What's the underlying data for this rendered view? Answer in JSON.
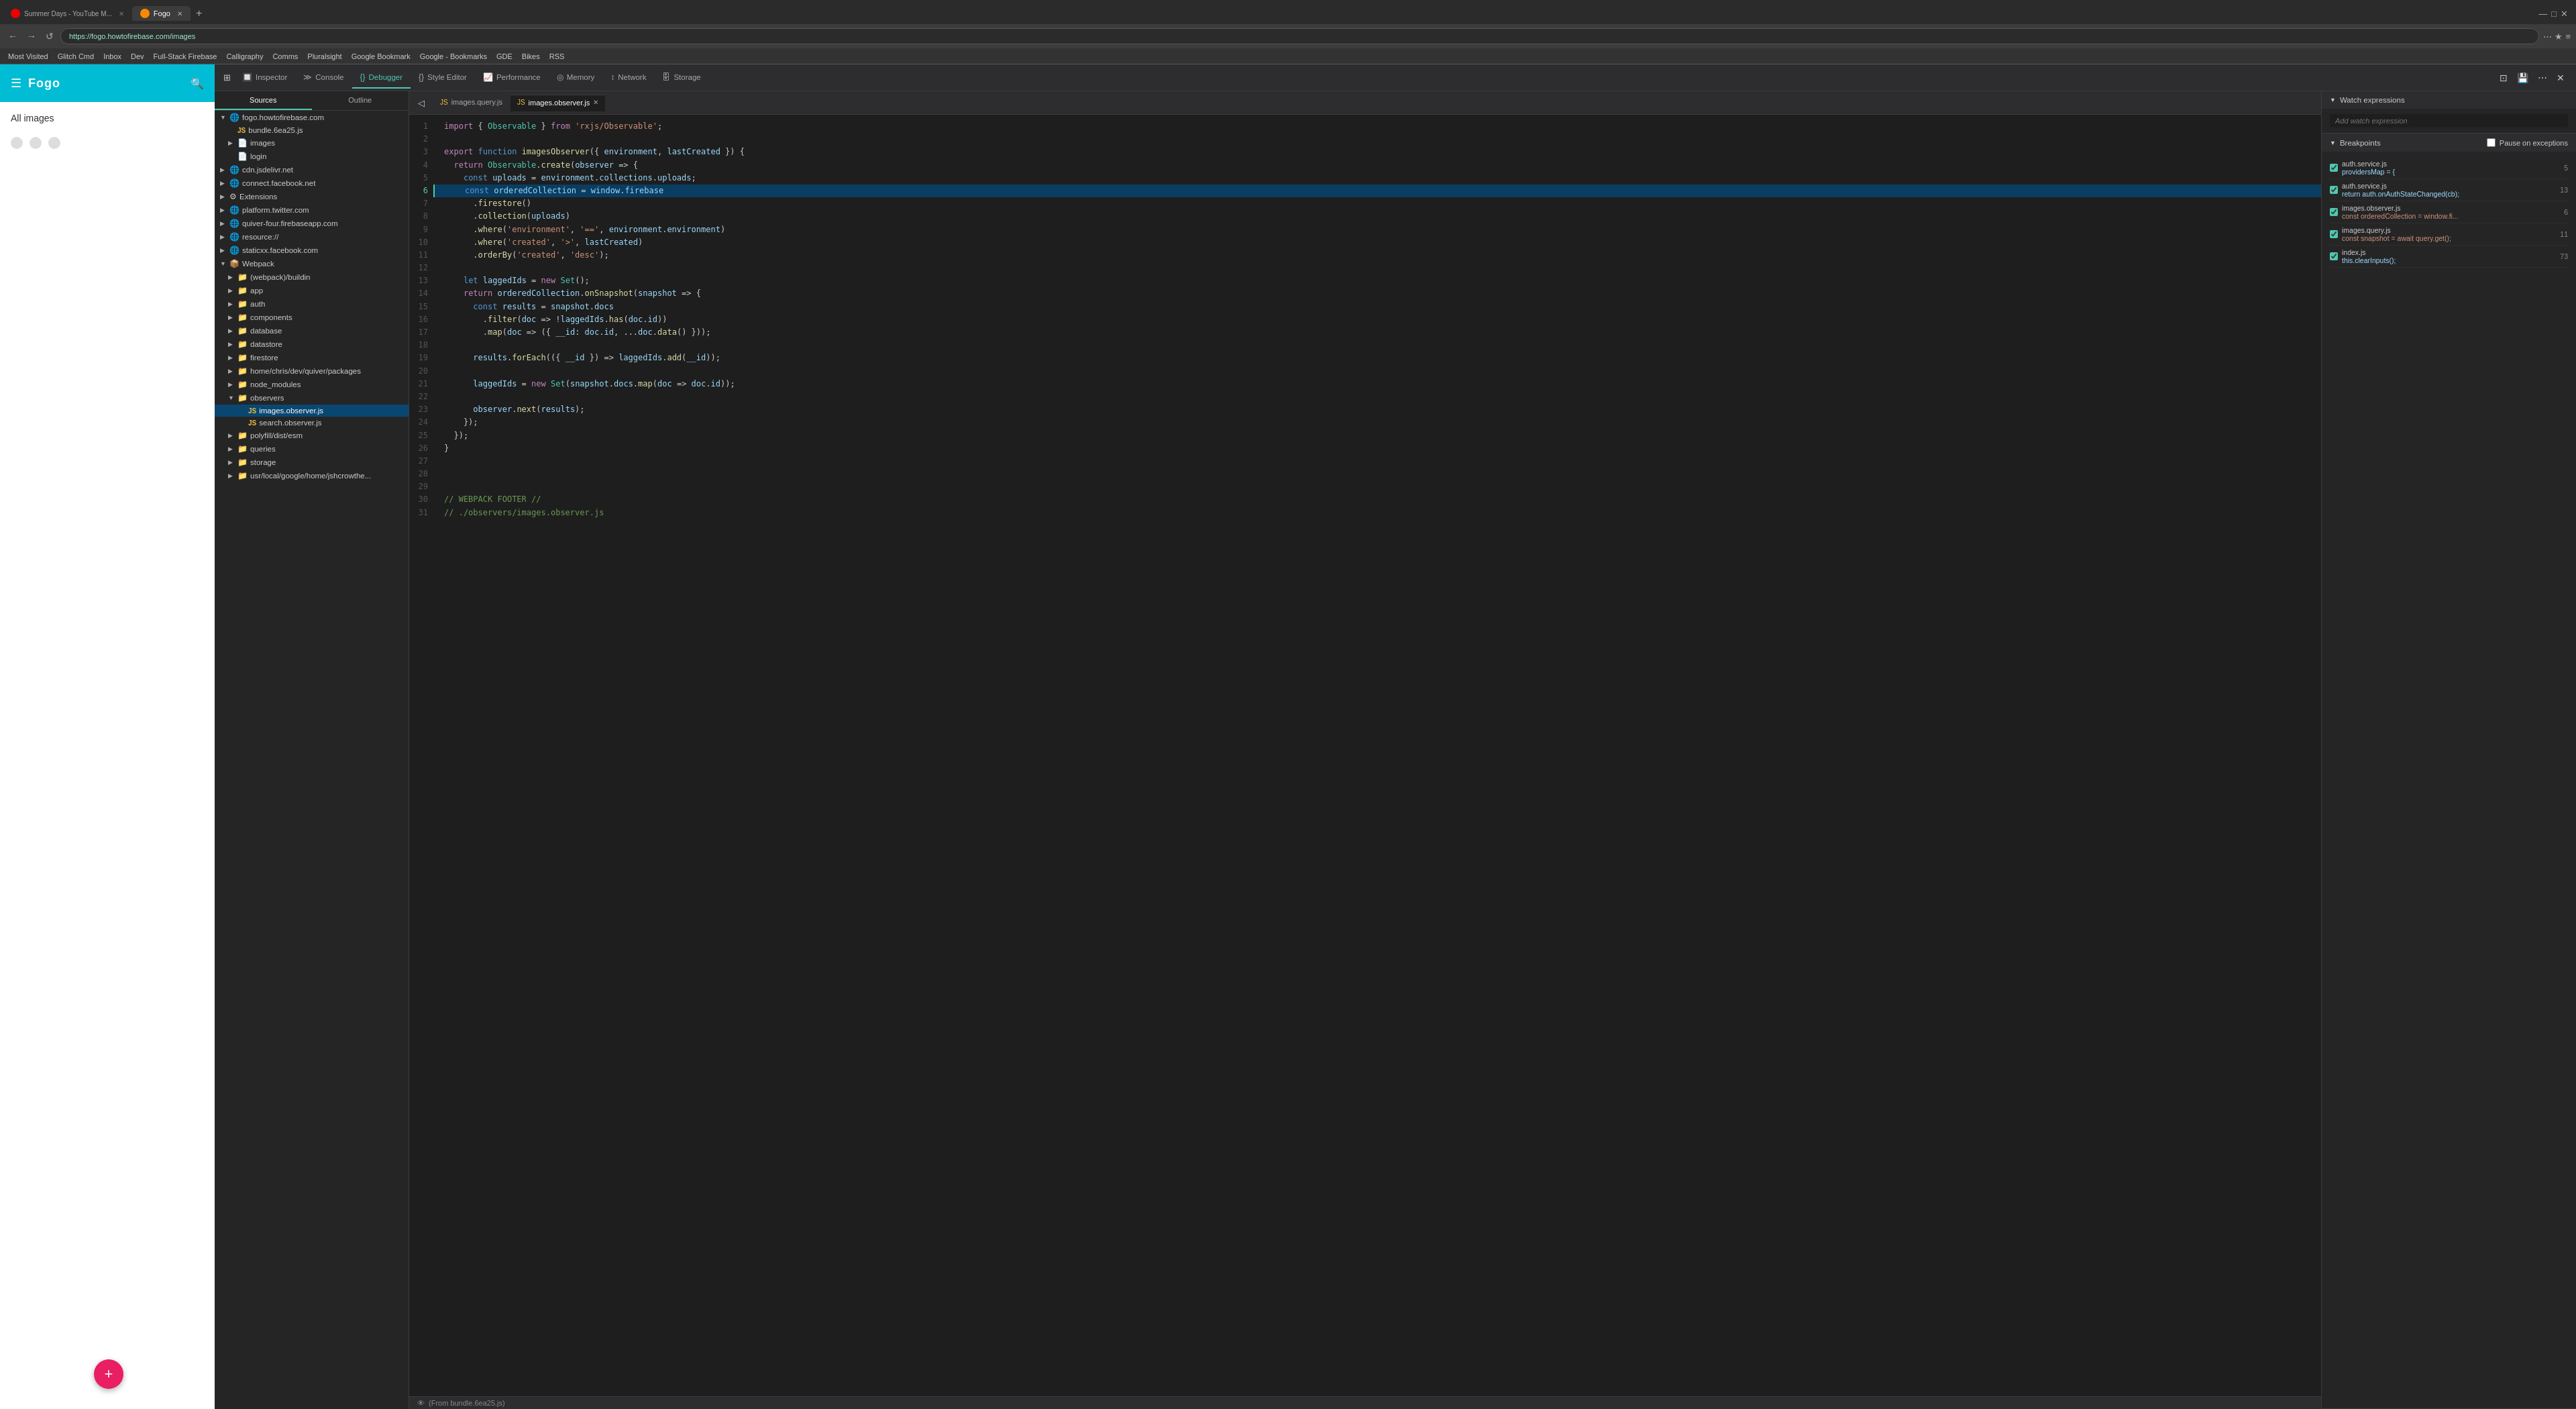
{
  "browser": {
    "tabs": [
      {
        "label": "Summer Days - YouTube M...",
        "favicon_color": "#e00",
        "active": false
      },
      {
        "label": "Fogo",
        "favicon_color": "#f60",
        "active": true
      }
    ],
    "url": "https://fogo.howtofirebase.com/images",
    "bookmarks": [
      "Most Visited",
      "Glitch Cmd",
      "Inbox",
      "Dev",
      "Full-Stack Firebase",
      "Calligraphy",
      "Comms",
      "Pluralsight",
      "Google Bookmark",
      "Google - Bookmarks",
      "GDE",
      "Bikes",
      "RSS"
    ]
  },
  "devtools": {
    "tabs": [
      {
        "label": "Inspector",
        "icon": "🔲",
        "active": false
      },
      {
        "label": "Console",
        "icon": "≡",
        "active": false
      },
      {
        "label": "Debugger",
        "icon": "{}",
        "active": true
      },
      {
        "label": "Style Editor",
        "icon": "{}",
        "active": false
      },
      {
        "label": "Performance",
        "icon": "📈",
        "active": false
      },
      {
        "label": "Memory",
        "icon": "◎",
        "active": false
      },
      {
        "label": "Network",
        "icon": "↕",
        "active": false
      },
      {
        "label": "Storage",
        "icon": "🗄",
        "active": false
      }
    ]
  },
  "sidebar_app": {
    "logo": "Fogo",
    "title": "All images"
  },
  "file_tree": {
    "tabs": [
      "Sources",
      "Outline"
    ],
    "items": [
      {
        "indent": 0,
        "arrow": "▼",
        "icon": "🌐",
        "label": "fogo.howtofirebase.com",
        "type": "domain"
      },
      {
        "indent": 1,
        "arrow": "",
        "icon": "JS",
        "label": "bundle.6ea25.js",
        "type": "js"
      },
      {
        "indent": 1,
        "arrow": "▶",
        "icon": "📄",
        "label": "images",
        "type": "folder"
      },
      {
        "indent": 1,
        "arrow": "",
        "icon": "📄",
        "label": "login",
        "type": "folder"
      },
      {
        "indent": 0,
        "arrow": "▶",
        "icon": "🌐",
        "label": "cdn.jsdelivr.net",
        "type": "domain"
      },
      {
        "indent": 0,
        "arrow": "▶",
        "icon": "🌐",
        "label": "connect.facebook.net",
        "type": "domain"
      },
      {
        "indent": 0,
        "arrow": "▶",
        "icon": "⚙",
        "label": "Extensions",
        "type": "domain"
      },
      {
        "indent": 0,
        "arrow": "▶",
        "icon": "🌐",
        "label": "platform.twitter.com",
        "type": "domain"
      },
      {
        "indent": 0,
        "arrow": "▶",
        "icon": "🌐",
        "label": "quiver-four.firebaseapp.com",
        "type": "domain"
      },
      {
        "indent": 0,
        "arrow": "▶",
        "icon": "🌐",
        "label": "resource://",
        "type": "domain"
      },
      {
        "indent": 0,
        "arrow": "▶",
        "icon": "🌐",
        "label": "staticxx.facebook.com",
        "type": "domain"
      },
      {
        "indent": 0,
        "arrow": "▼",
        "icon": "📦",
        "label": "Webpack",
        "type": "domain"
      },
      {
        "indent": 1,
        "arrow": "▶",
        "icon": "📁",
        "label": "(webpack)/buildin",
        "type": "folder"
      },
      {
        "indent": 1,
        "arrow": "▶",
        "icon": "📁",
        "label": "app",
        "type": "folder"
      },
      {
        "indent": 1,
        "arrow": "▶",
        "icon": "📁",
        "label": "auth",
        "type": "folder"
      },
      {
        "indent": 1,
        "arrow": "▶",
        "icon": "📁",
        "label": "components",
        "type": "folder"
      },
      {
        "indent": 1,
        "arrow": "▶",
        "icon": "📁",
        "label": "database",
        "type": "folder"
      },
      {
        "indent": 1,
        "arrow": "▶",
        "icon": "📁",
        "label": "datastore",
        "type": "folder"
      },
      {
        "indent": 1,
        "arrow": "▶",
        "icon": "📁",
        "label": "firestore",
        "type": "folder"
      },
      {
        "indent": 1,
        "arrow": "▶",
        "icon": "📁",
        "label": "home/chris/dev/quiver/packages",
        "type": "folder"
      },
      {
        "indent": 1,
        "arrow": "▶",
        "icon": "📁",
        "label": "node_modules",
        "type": "folder"
      },
      {
        "indent": 1,
        "arrow": "▼",
        "icon": "📁",
        "label": "observers",
        "type": "folder"
      },
      {
        "indent": 2,
        "arrow": "",
        "icon": "JS",
        "label": "images.observer.js",
        "type": "js",
        "selected": true
      },
      {
        "indent": 2,
        "arrow": "",
        "icon": "JS",
        "label": "search.observer.js",
        "type": "js"
      },
      {
        "indent": 1,
        "arrow": "▶",
        "icon": "📁",
        "label": "polyfill/dist/esm",
        "type": "folder"
      },
      {
        "indent": 1,
        "arrow": "▶",
        "icon": "📁",
        "label": "queries",
        "type": "folder"
      },
      {
        "indent": 1,
        "arrow": "▶",
        "icon": "📁",
        "label": "storage",
        "type": "folder"
      },
      {
        "indent": 1,
        "arrow": "▶",
        "icon": "📁",
        "label": "usr/local/google/home/jshcrowthe...",
        "type": "folder"
      }
    ]
  },
  "code_editor": {
    "tabs": [
      {
        "label": "images.query.js",
        "active": false,
        "closeable": false
      },
      {
        "label": "images.observer.js",
        "active": true,
        "closeable": true
      }
    ],
    "lines": [
      {
        "n": 1,
        "code": "<kw>import</kw> { <cls>Observable</cls> } <kw>from</kw> <str>'rxjs/Observable'</str>;",
        "highlight": false
      },
      {
        "n": 2,
        "code": "",
        "highlight": false
      },
      {
        "n": 3,
        "code": "<kw>export</kw> <kw2>function</kw2> <fn>imagesObserver</fn>({ <var>environment</var>, <var>lastCreated</var> }) {",
        "highlight": false
      },
      {
        "n": 4,
        "code": "  <kw>return</kw> <cls>Observable</cls>.<fn>create</fn>(<var>observer</var> => {",
        "highlight": false
      },
      {
        "n": 5,
        "code": "    <kw2>const</kw2> <var>uploads</var> = <var>environment</var>.<prop>collections</prop>.<prop>uploads</prop>;",
        "highlight": false
      },
      {
        "n": 6,
        "code": "    <kw2>const</kw2> <var>orderedCollection</var> = <var>window</var>.<prop>firebase</prop>",
        "highlight": true,
        "breakpoint": true
      },
      {
        "n": 7,
        "code": "      .<fn>firestore</fn>()",
        "highlight": false
      },
      {
        "n": 8,
        "code": "      .<fn>collection</fn>(<var>uploads</var>)",
        "highlight": false
      },
      {
        "n": 9,
        "code": "      .<fn>where</fn>(<str>'environment'</str>, <str>'=='</str>, <var>environment</var>.<prop>environment</prop>)",
        "highlight": false
      },
      {
        "n": 10,
        "code": "      .<fn>where</fn>(<str>'created'</str>, <str>'>'</str>, <var>lastCreated</var>)",
        "highlight": false
      },
      {
        "n": 11,
        "code": "      .<fn>orderBy</fn>(<str>'created'</str>, <str>'desc'</str>);",
        "highlight": false
      },
      {
        "n": 12,
        "code": "",
        "highlight": false
      },
      {
        "n": 13,
        "code": "    <kw2>let</kw2> <var>laggedIds</var> = <kw>new</kw> <cls>Set</cls>();",
        "highlight": false
      },
      {
        "n": 14,
        "code": "    <kw>return</kw> <var>orderedCollection</var>.<fn>onSnapshot</fn>(<var>snapshot</var> => {",
        "highlight": false
      },
      {
        "n": 15,
        "code": "      <kw2>const</kw2> <var>results</var> = <var>snapshot</var>.<prop>docs</prop>",
        "highlight": false
      },
      {
        "n": 16,
        "code": "        .<fn>filter</fn>(<var>doc</var> => !<var>laggedIds</var>.<fn>has</fn>(<var>doc</var>.<prop>id</prop>))",
        "highlight": false
      },
      {
        "n": 17,
        "code": "        .<fn>map</fn>(<var>doc</var> => ({ <var>__id</var>: <var>doc</var>.<prop>id</prop>, ...<var>doc</var>.<fn>data</fn>() }));",
        "highlight": false
      },
      {
        "n": 18,
        "code": "",
        "highlight": false
      },
      {
        "n": 19,
        "code": "      <var>results</var>.<fn>forEach</fn>(({ <var>__id</var> }) => <var>laggedIds</var>.<fn>add</fn>(<var>__id</var>));",
        "highlight": false
      },
      {
        "n": 20,
        "code": "",
        "highlight": false
      },
      {
        "n": 21,
        "code": "      <var>laggedIds</var> = <kw>new</kw> <cls>Set</cls>(<var>snapshot</var>.<prop>docs</prop>.<fn>map</fn>(<var>doc</var> => <var>doc</var>.<prop>id</prop>));",
        "highlight": false
      },
      {
        "n": 22,
        "code": "",
        "highlight": false
      },
      {
        "n": 23,
        "code": "      <var>observer</var>.<fn>next</fn>(<var>results</var>);",
        "highlight": false
      },
      {
        "n": 24,
        "code": "    });",
        "highlight": false
      },
      {
        "n": 25,
        "code": "  });",
        "highlight": false
      },
      {
        "n": 26,
        "code": "}",
        "highlight": false
      },
      {
        "n": 27,
        "code": "",
        "highlight": false
      },
      {
        "n": 28,
        "code": "",
        "highlight": false
      },
      {
        "n": 29,
        "code": "",
        "highlight": false
      },
      {
        "n": 30,
        "code": "<cm>// WEBPACK FOOTER //</cm>",
        "highlight": false
      },
      {
        "n": 31,
        "code": "<cm>// ./observers/images.observer.js</cm>",
        "highlight": false
      }
    ],
    "status": "(From bundle.6ea25.js)"
  },
  "right_panel": {
    "watch_expressions": {
      "title": "Watch expressions",
      "placeholder": "Add watch expression"
    },
    "breakpoints": {
      "title": "Breakpoints",
      "pause_on_exceptions": "Pause on exceptions",
      "items": [
        {
          "file": "auth.service.js",
          "code": "providersMap = {",
          "line": "5",
          "checked": true
        },
        {
          "file": "auth.service.js",
          "code": "return auth.onAuthStateChanged(cb);",
          "line": "13",
          "checked": true
        },
        {
          "file": "images.observer.js",
          "code": "const orderedCollection = window.fi...",
          "line": "6",
          "checked": true
        },
        {
          "file": "images.query.js",
          "code": "const snapshot = await query.get();",
          "line": "11",
          "checked": true
        },
        {
          "file": "index.js",
          "code": "this.clearInputs();",
          "line": "73",
          "checked": true
        }
      ]
    }
  }
}
